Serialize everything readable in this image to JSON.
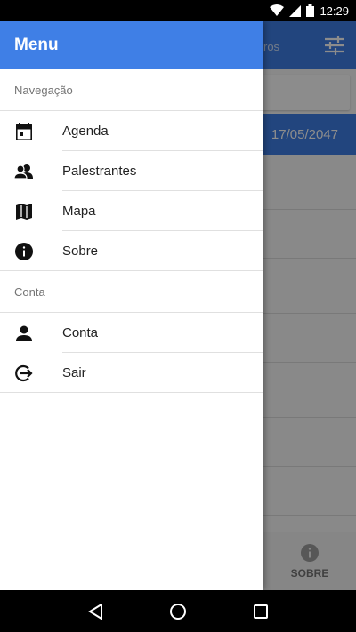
{
  "status_bar": {
    "time": "12:29",
    "icons": [
      "wifi-icon",
      "signal-icon",
      "battery-icon"
    ]
  },
  "app": {
    "search_hint": "ros",
    "date_label": "17/05/2047",
    "bottom_nav": {
      "about_label": "SOBRE"
    },
    "colors": {
      "primary": "#3f7fe6"
    }
  },
  "drawer": {
    "title": "Menu",
    "sections": [
      {
        "label": "Navegação",
        "items": [
          {
            "label": "Agenda",
            "icon": "calendar-icon"
          },
          {
            "label": "Palestrantes",
            "icon": "people-icon"
          },
          {
            "label": "Mapa",
            "icon": "map-icon"
          },
          {
            "label": "Sobre",
            "icon": "info-icon"
          }
        ]
      },
      {
        "label": "Conta",
        "items": [
          {
            "label": "Conta",
            "icon": "person-icon"
          },
          {
            "label": "Sair",
            "icon": "logout-icon"
          }
        ]
      }
    ]
  },
  "nav_bar": {
    "buttons": [
      "back-icon",
      "home-icon",
      "recents-icon"
    ]
  }
}
